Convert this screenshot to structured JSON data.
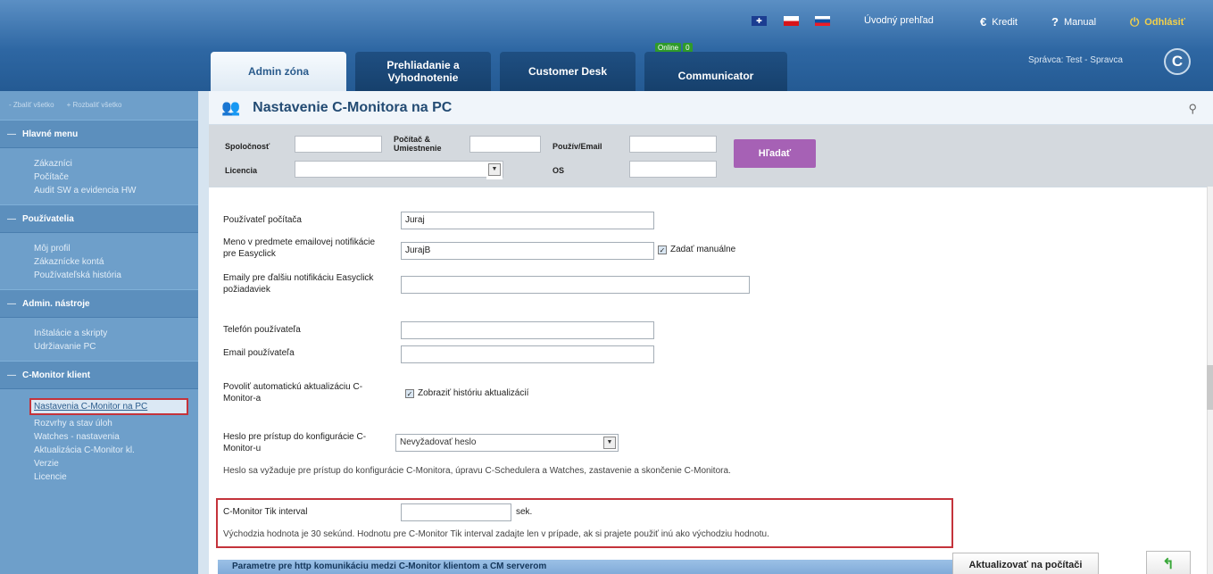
{
  "header": {
    "flags": [
      "uk-flag",
      "cz-flag",
      "sk-flag"
    ],
    "links": {
      "uvod": "Úvodný prehľad",
      "kredit": "Kredit",
      "manual": "Manual",
      "odhlasit": "Odhlásiť"
    },
    "tabs": [
      {
        "label": "Admin zóna"
      },
      {
        "label": "Prehliadanie a Vyhodnotenie"
      },
      {
        "label": "Customer Desk"
      },
      {
        "label": "Communicator"
      }
    ],
    "online_badge": {
      "label": "Online",
      "count": "0"
    },
    "spravca": "Správca: Test - Spravca",
    "logo": "C"
  },
  "sidebar": {
    "collapse_all": "- Zbaliť všetko",
    "expand_all": "+ Rozbaliť všetko",
    "sections": [
      {
        "title": "Hlavné menu",
        "items": [
          "Zákazníci",
          "Počítače",
          "Audit SW a evidencia HW"
        ]
      },
      {
        "title": "Používatelia",
        "items": [
          "Môj profil",
          "Zákaznícke kontá",
          "Používateľská história"
        ]
      },
      {
        "title": "Admin. nástroje",
        "items": [
          "Inštalácie a skripty",
          "Udržiavanie PC"
        ]
      },
      {
        "title": "C-Monitor klient",
        "items": [
          "Nastavenia C-Monitor na PC",
          "Rozvrhy a stav úloh",
          "Watches - nastavenia",
          "Aktualizácia C-Monitor kl.",
          "Verzie",
          "Licencie"
        ]
      }
    ]
  },
  "page": {
    "title": "Nastavenie C-Monitora na PC",
    "filter": {
      "spolocnost": "Spoločnosť",
      "pocitac": "Počítač & Umiestnenie",
      "pouziv": "Použív/Email",
      "licencia": "Licencia",
      "os": "OS",
      "search_button": "Hľadať"
    },
    "form": {
      "pouzivatel_label": "Používateľ počítača",
      "pouzivatel_value": "Juraj",
      "meno_label": "Meno v predmete emailovej notifikácie pre Easyclick",
      "meno_value": "JurajB",
      "zadat_manualne": "Zadať manuálne",
      "emaily_label": "Emaily pre ďalšiu notifikáciu Easyclick požiadaviek",
      "telefon_label": "Telefón používateľa",
      "email_label": "Email používateľa",
      "povolit_label": "Povoliť automatickú aktualizáciu C-Monitor-a",
      "zobrazit_historiu": "Zobraziť históriu aktualizácií",
      "heslo_label": "Heslo pre prístup do konfigurácie C-Monitor-u",
      "heslo_value": "Nevyžadovať heslo",
      "heslo_note": "Heslo sa vyžaduje pre prístup do konfigurácie C-Monitora, úpravu C-Schedulera a Watches, zastavenie a skončenie C-Monitora.",
      "tik_label": "C-Monitor Tik interval",
      "tik_unit": "sek.",
      "tik_note": "Východzia hodnota je 30 sekúnd. Hodnotu pre C-Monitor Tik interval zadajte len v prípade, ak si prajete použiť inú ako východziu hodnotu.",
      "params_header": "Parametre pre http komunikáciu medzi C-Monitor klientom a CM serverom",
      "update_button": "Aktualizovať na počítači"
    }
  }
}
